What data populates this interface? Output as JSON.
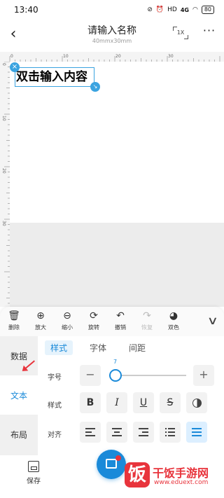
{
  "status_bar": {
    "time": "13:40",
    "icons": [
      "mute-icon",
      "alarm-icon",
      "hd-icon",
      "signal-icon",
      "wifi-icon"
    ],
    "signal_text": "4G",
    "battery": "80"
  },
  "nav": {
    "back_icon": "‹",
    "title": "请输入名称",
    "subtitle": "40mmx30mm",
    "zoom_label": "1X",
    "more_icon": "···"
  },
  "ruler": {
    "top_labels": [
      "0",
      "10",
      "20",
      "30"
    ],
    "left_labels": [
      "0",
      "10",
      "20",
      "30"
    ]
  },
  "canvas": {
    "text_content": "双击输入内容",
    "close_handle": "×",
    "resize_handle": "↘"
  },
  "toolbar": {
    "items": [
      {
        "label": "删除",
        "icon": "🗑"
      },
      {
        "label": "放大",
        "icon": "⊕"
      },
      {
        "label": "缩小",
        "icon": "⊖"
      },
      {
        "label": "旋转",
        "icon": "⟳"
      },
      {
        "label": "撤销",
        "icon": "↶"
      },
      {
        "label": "恢复",
        "icon": "↷"
      },
      {
        "label": "双色",
        "icon": "◕"
      }
    ],
    "collapse_icon": "∨"
  },
  "side_nav": {
    "items": [
      "数据",
      "文本",
      "布局"
    ],
    "active": "文本"
  },
  "sub_tabs": {
    "items": [
      "样式",
      "字体",
      "间距"
    ],
    "active": "样式"
  },
  "font_size": {
    "label": "字号",
    "value": "7",
    "minus": "−",
    "plus": "+"
  },
  "style_row": {
    "label": "样式",
    "buttons": [
      "B",
      "I",
      "U",
      "S"
    ]
  },
  "align_row": {
    "label": "对齐"
  },
  "bottom": {
    "save_label": "保存"
  },
  "watermark": {
    "logo_char": "饭",
    "title": "干饭手游网",
    "url": "www.eduext.com"
  },
  "colors": {
    "accent": "#1a8ad9",
    "selection": "#3aa3e0",
    "watermark": "#e8343c"
  }
}
